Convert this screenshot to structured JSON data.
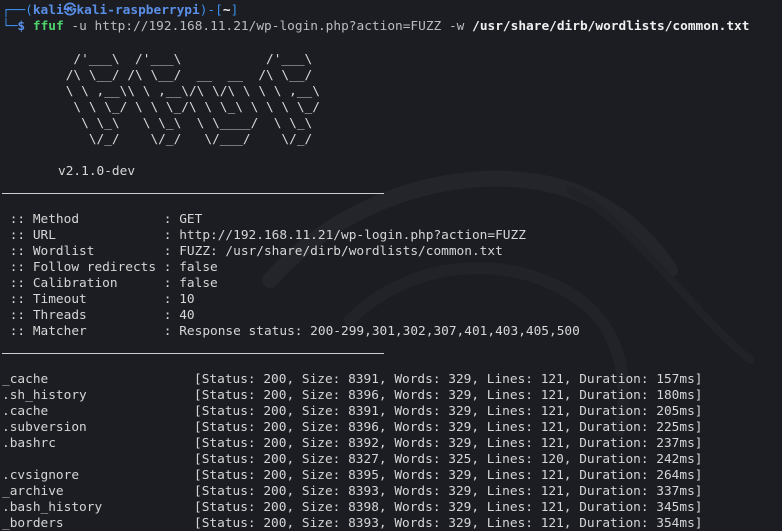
{
  "prompt": {
    "corner_top": "┌──(",
    "user_host": "kali㉿kali-raspberrypi",
    "close_paren": ")-[",
    "dir": "~",
    "close_bracket": "]",
    "corner_bottom": "└─",
    "dollar": "$",
    "cmd_name": "ffuf",
    "flag_u": "-u",
    "url": "http://192.168.11.21/wp-login.php?action=FUZZ",
    "flag_w": "-w",
    "wordlist": "/usr/share/dirb/wordlists/common.txt"
  },
  "banner": {
    "art": "  /'___\\  /'___\\           /'___\\\n /\\ \\__/ /\\ \\__/  __  __  /\\ \\__/\n \\ \\ ,__\\\\ \\ ,__\\/\\ \\/\\ \\ \\ \\ ,__\\\n  \\ \\ \\_/ \\ \\ \\_/\\ \\ \\_\\ \\ \\ \\ \\_/\n   \\ \\_\\   \\ \\_\\  \\ \\____/  \\ \\_\\\n    \\/_/    \\/_/   \\/___/    \\/_/",
    "version": "v2.1.0-dev"
  },
  "config": [
    {
      "key": " :: Method           : ",
      "value": "GET"
    },
    {
      "key": " :: URL              : ",
      "value": "http://192.168.11.21/wp-login.php?action=FUZZ"
    },
    {
      "key": " :: Wordlist         : ",
      "value": "FUZZ: /usr/share/dirb/wordlists/common.txt"
    },
    {
      "key": " :: Follow redirects : ",
      "value": "false"
    },
    {
      "key": " :: Calibration      : ",
      "value": "false"
    },
    {
      "key": " :: Timeout          : ",
      "value": "10"
    },
    {
      "key": " :: Threads          : ",
      "value": "40"
    },
    {
      "key": " :: Matcher          : ",
      "value": "Response status: 200-299,301,302,307,401,403,405,500"
    }
  ],
  "results": [
    {
      "name": "_cache",
      "info": "[Status: 200, Size: 8391, Words: 329, Lines: 121, Duration: 157ms]"
    },
    {
      "name": ".sh_history",
      "info": "[Status: 200, Size: 8396, Words: 329, Lines: 121, Duration: 180ms]"
    },
    {
      "name": ".cache",
      "info": "[Status: 200, Size: 8391, Words: 329, Lines: 121, Duration: 205ms]"
    },
    {
      "name": ".subversion",
      "info": "[Status: 200, Size: 8396, Words: 329, Lines: 121, Duration: 225ms]"
    },
    {
      "name": ".bashrc",
      "info": "[Status: 200, Size: 8392, Words: 329, Lines: 121, Duration: 237ms]"
    },
    {
      "name": "",
      "info": "[Status: 200, Size: 8327, Words: 325, Lines: 120, Duration: 242ms]"
    },
    {
      "name": ".cvsignore",
      "info": "[Status: 200, Size: 8395, Words: 329, Lines: 121, Duration: 264ms]"
    },
    {
      "name": "_archive",
      "info": "[Status: 200, Size: 8393, Words: 329, Lines: 121, Duration: 337ms]"
    },
    {
      "name": ".bash_history",
      "info": "[Status: 200, Size: 8398, Words: 329, Lines: 121, Duration: 345ms]"
    },
    {
      "name": "_borders",
      "info": "[Status: 200, Size: 8393, Words: 329, Lines: 121, Duration: 354ms]"
    }
  ]
}
